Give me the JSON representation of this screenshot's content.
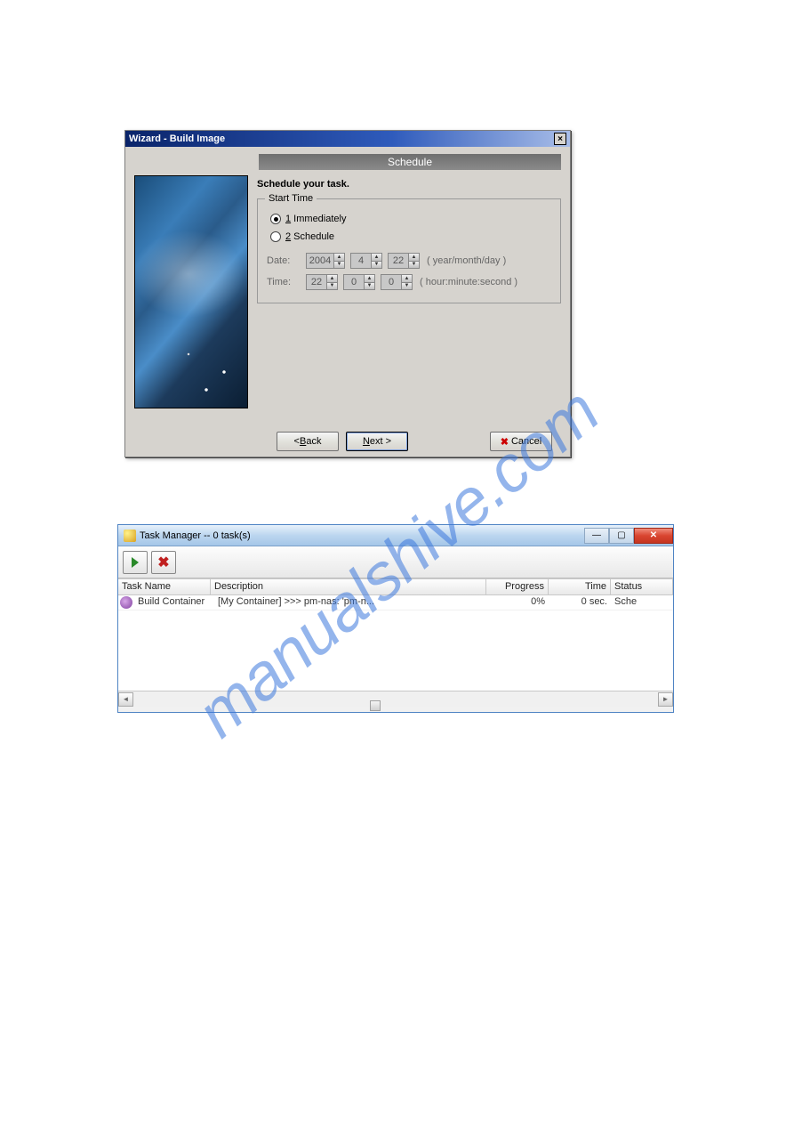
{
  "watermark": "manualshive.com",
  "wizard": {
    "title": "Wizard - Build Image",
    "banner": "Schedule",
    "heading": "Schedule your task.",
    "legend": "Start Time",
    "radio1_prefix": "1",
    "radio1_label": " Immediately",
    "radio2_prefix": "2",
    "radio2_label": " Schedule",
    "date_label": "Date:",
    "time_label": "Time:",
    "date_year": "2004",
    "date_month": "4",
    "date_day": "22",
    "time_hour": "22",
    "time_min": "0",
    "time_sec": "0",
    "date_hint": "( year/month/day )",
    "time_hint": "( hour:minute:second )",
    "back_btn_prefix": "< ",
    "back_btn_u": "B",
    "back_btn_rest": "ack",
    "next_btn_u": "N",
    "next_btn_rest": "ext >",
    "cancel_btn": "Cancel"
  },
  "tm": {
    "title": "Task Manager -- 0 task(s)",
    "cols": {
      "name": "Task Name",
      "desc": "Description",
      "prog": "Progress",
      "time": "Time",
      "stat": "Status"
    },
    "row": {
      "name": "Build Container",
      "desc": "[My Container] >>> pm-nas: 'pm-n...",
      "prog": "0%",
      "time": "0 sec.",
      "stat": "Sche"
    }
  }
}
